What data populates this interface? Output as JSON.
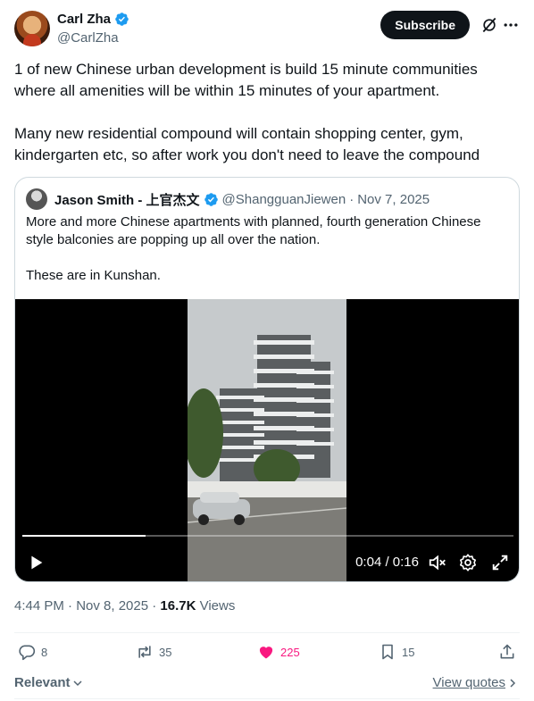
{
  "author": {
    "name": "Carl Zha",
    "handle": "@CarlZha"
  },
  "header": {
    "subscribe_label": "Subscribe"
  },
  "tweet": {
    "paragraphs": [
      "1 of new Chinese urban development is build 15 minute communities where all amenities will be within 15 minutes of your apartment.",
      "Many new residential compound will contain shopping center, gym, kindergarten etc, so after work you don't need to leave the compound"
    ]
  },
  "quote": {
    "name": "Jason Smith - 上官杰文",
    "handle": "@ShangguanJiewen",
    "separator": "·",
    "date": "Nov 7, 2025",
    "paragraphs": [
      "More and more Chinese apartments with planned, fourth generation Chinese style balconies are popping up all over the nation.",
      "These are in Kunshan."
    ],
    "video": {
      "time": "0:04 / 0:16",
      "progress_fraction": 0.25
    }
  },
  "meta": {
    "timestamp": "4:44 PM · Nov 8, 2025 · ",
    "views_count": "16.7K",
    "views_label": " Views"
  },
  "actions": {
    "replies": "8",
    "reposts": "35",
    "likes": "225",
    "bookmarks": "15"
  },
  "footer": {
    "sort_label": "Relevant",
    "view_quotes_label": "View quotes"
  },
  "colors": {
    "accent_blue": "#1d9bf0",
    "like_pink": "#f91880",
    "text_primary": "#0f1419",
    "text_secondary": "#536471"
  }
}
